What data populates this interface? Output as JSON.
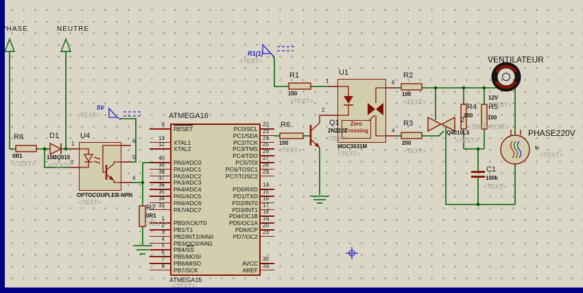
{
  "placeholder": "<TEXT>",
  "nets": {
    "v5": "5V",
    "r1net": "R1(1)"
  },
  "terminals": {
    "phase": "PHASE",
    "neutre": "NEUTRE"
  },
  "parts": {
    "r8": {
      "ref": "R8",
      "value": "0R1"
    },
    "d1": {
      "ref": "D1",
      "value": "10BQ015"
    },
    "u4": {
      "ref": "U4",
      "value": "OPTOCOUPLER-NPN"
    },
    "r7": {
      "ref": "R7",
      "value": "0R1"
    },
    "r1": {
      "ref": "R1",
      "value": "100"
    },
    "r6": {
      "ref": "R6",
      "value": "100"
    },
    "q1": {
      "ref": "Q1",
      "value": "2N2222"
    },
    "u1": {
      "ref": "U1",
      "value": "MOC3031M",
      "inner": "Zero Crossing"
    },
    "r2": {
      "ref": "R2",
      "value": "100"
    },
    "r3": {
      "ref": "R3",
      "value": "200"
    },
    "u2": {
      "ref": "2",
      "value": "Q4010L5"
    },
    "r4": {
      "ref": "R4",
      "value": "200"
    },
    "r5": {
      "ref": "R5",
      "value": "100"
    },
    "c1": {
      "ref": "C1",
      "value": "100k"
    },
    "motor": {
      "ref": "VENTILATEUR",
      "value": "12V"
    },
    "alt": {
      "ref": "PHASE220V",
      "value": "u."
    }
  },
  "opto_pins": {
    "u4": [
      "1",
      "2",
      "6",
      "5",
      "4"
    ],
    "u1": [
      "1",
      "2",
      "6",
      "4"
    ]
  },
  "atmega": {
    "title": "ATMEGA16",
    "sub": "ATMEGA16",
    "left": [
      {
        "r": 0,
        "n": "9",
        "ol": "RESET"
      },
      {
        "r": 2,
        "n": "13",
        "l": "XTAL1"
      },
      {
        "r": 3,
        "n": "12",
        "l": "XTAL2"
      },
      {
        "r": 5,
        "n": "40",
        "l": "PA0/ADC0"
      },
      {
        "r": 6,
        "n": "39",
        "l": "PA1/ADC1"
      },
      {
        "r": 7,
        "n": "38",
        "l": "PA2/ADC2"
      },
      {
        "r": 8,
        "n": "37",
        "l": "PA3/ADC3"
      },
      {
        "r": 9,
        "n": "36",
        "l": "PA4/ADC4"
      },
      {
        "r": 10,
        "n": "35",
        "l": "PA5/ADC5"
      },
      {
        "r": 11,
        "n": "34",
        "l": "PA6/ADC6"
      },
      {
        "r": 12,
        "n": "33",
        "l": "PA7/ADC7"
      },
      {
        "r": 14,
        "n": "1",
        "l": "PB0/XCK/T0"
      },
      {
        "r": 15,
        "n": "2",
        "l": "PB1/T1"
      },
      {
        "r": 16,
        "n": "3",
        "l": "PB2/INT2/AIN0"
      },
      {
        "r": 17,
        "n": "4",
        "l": "PB3/OC0/AIN1"
      },
      {
        "r": 18,
        "n": "5",
        "pre": "PB4/",
        "ol": "SS"
      },
      {
        "r": 19,
        "n": "6",
        "l": "PB5/MOSI"
      },
      {
        "r": 20,
        "n": "7",
        "l": "PB6/MISO"
      },
      {
        "r": 21,
        "n": "8",
        "l": "PB7/SCK"
      }
    ],
    "right": [
      {
        "r": 0,
        "n": "22",
        "l": "PC0/SCL"
      },
      {
        "r": 1,
        "n": "23",
        "l": "PC1/SDA"
      },
      {
        "r": 2,
        "n": "24",
        "l": "PC2/TCK"
      },
      {
        "r": 3,
        "n": "25",
        "l": "PC3/TMS"
      },
      {
        "r": 4,
        "n": "26",
        "l": "PC4/TDO"
      },
      {
        "r": 5,
        "n": "27",
        "l": "PC5/TDI"
      },
      {
        "r": 6,
        "n": "28",
        "l": "PC6/TOSC1"
      },
      {
        "r": 7,
        "n": "29",
        "l": "PC7/TOSC2"
      },
      {
        "r": 9,
        "n": "14",
        "l": "PD0/RXD"
      },
      {
        "r": 10,
        "n": "15",
        "l": "PD1/TXD"
      },
      {
        "r": 11,
        "n": "16",
        "l": "PD2/INT0"
      },
      {
        "r": 12,
        "n": "17",
        "l": "PD3/INT1"
      },
      {
        "r": 13,
        "n": "18",
        "l": "PD4/OC1B"
      },
      {
        "r": 14,
        "n": "19",
        "l": "PD5/OC1A"
      },
      {
        "r": 15,
        "n": "20",
        "l": "PD6/ICP"
      },
      {
        "r": 16,
        "n": "21",
        "l": "PD7/OC2"
      },
      {
        "r": 20,
        "n": "30",
        "l": "AVCC"
      },
      {
        "r": 21,
        "n": "32",
        "l": "AREF"
      }
    ]
  },
  "colors": {
    "wire": "#056305",
    "component": "#8a1505",
    "body_fill": "#d2ceae",
    "sheet": "#dbd7c7",
    "border": "#000082",
    "net_label": "#1c1ccc",
    "placeholder_gray": "#9b978b"
  }
}
